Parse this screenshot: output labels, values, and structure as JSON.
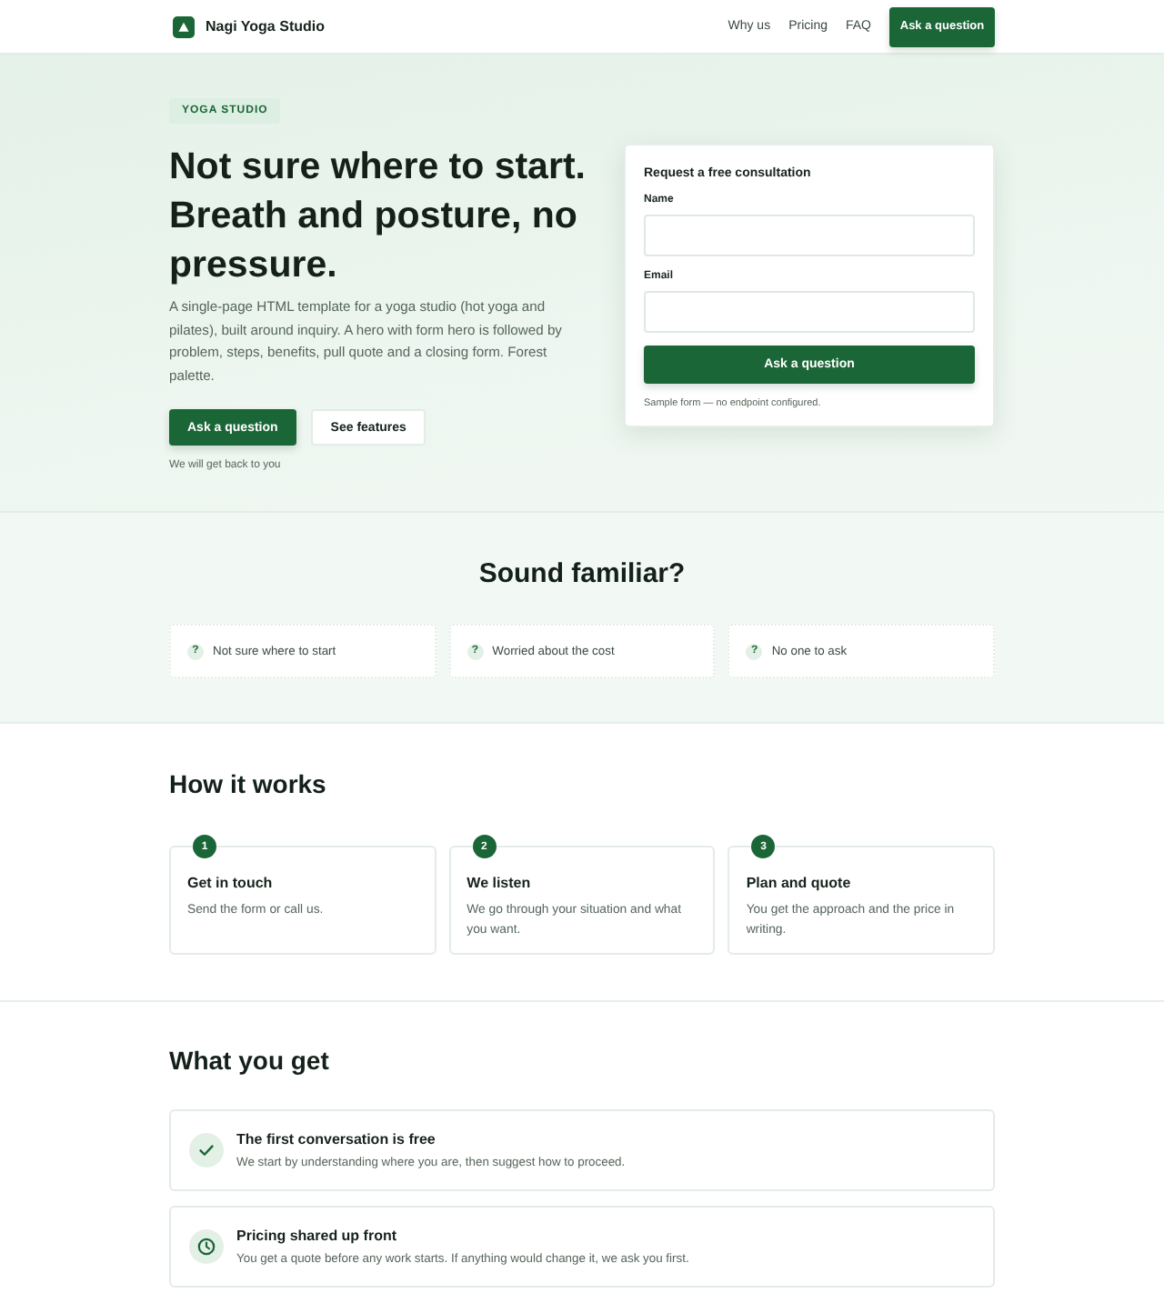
{
  "header": {
    "brand": "Nagi Yoga Studio",
    "nav": [
      "Why us",
      "Pricing",
      "FAQ"
    ],
    "cta": "Ask a question"
  },
  "hero": {
    "eyebrow": "YOGA STUDIO",
    "title": "Not sure where to start. Breath and posture, no pressure.",
    "text": "A single-page HTML template for a yoga studio (hot yoga and pilates), built around inquiry. A hero with form hero is followed by problem, steps, benefits, pull quote and a closing form. Forest palette.",
    "buttons": [
      {
        "label": "Ask a question",
        "kind": "primary"
      },
      {
        "label": "See features",
        "kind": "secondary"
      }
    ],
    "note": "We will get back to you"
  },
  "form": {
    "title": "Request a free consultation",
    "fields": [
      {
        "label": "Name"
      },
      {
        "label": "Email"
      }
    ],
    "submit": "Ask a question",
    "note": "Sample form — no endpoint configured."
  },
  "problems": {
    "title": "Sound familiar?",
    "items": [
      {
        "mark": "?",
        "text": "Not sure where to start"
      },
      {
        "mark": "?",
        "text": "Worried about the cost"
      },
      {
        "mark": "?",
        "text": "No one to ask"
      }
    ]
  },
  "steps": {
    "title": "How it works",
    "items": [
      {
        "number": "1",
        "title": "Get in touch",
        "text": "Send the form or call us."
      },
      {
        "number": "2",
        "title": "We listen",
        "text": "We go through your situation and what you want."
      },
      {
        "number": "3",
        "title": "Plan and quote",
        "text": "You get the approach and the price in writing."
      }
    ]
  },
  "benefits": {
    "title": "What you get",
    "items": [
      {
        "kind": "check",
        "title": "The first conversation is free",
        "text": "We start by understanding where you are, then suggest how to proceed."
      },
      {
        "kind": "clock",
        "title": "Pricing shared up front",
        "text": "You get a quote before any work starts. If anything would change it, we ask you first."
      }
    ]
  }
}
